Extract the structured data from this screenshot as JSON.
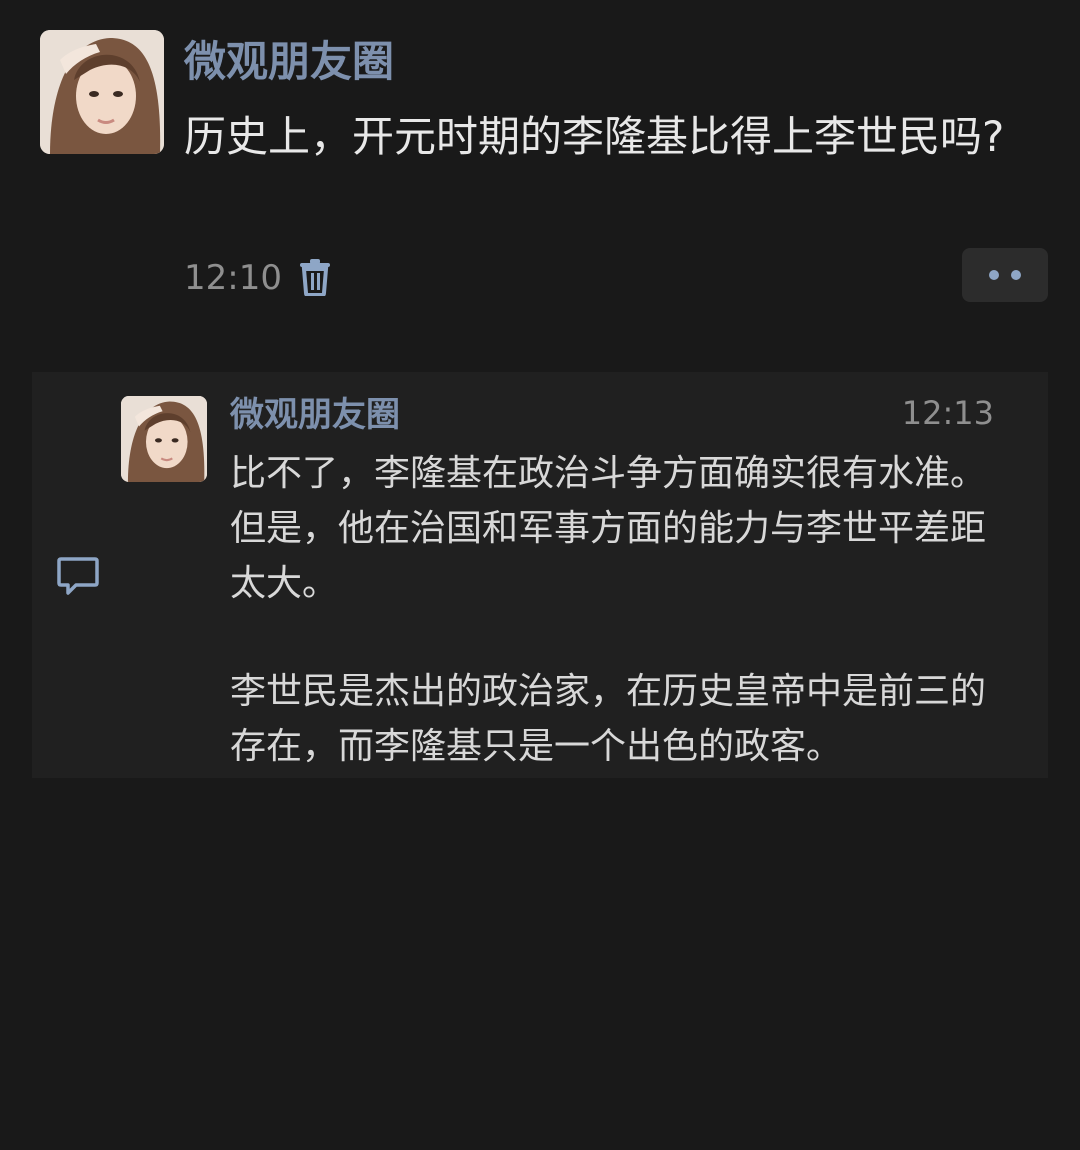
{
  "post": {
    "author": "微观朋友圈",
    "text": "历史上，开元时期的李隆基比得上李世民吗?",
    "time": "12:10",
    "delete_icon": "trash-icon",
    "more_icon": "two-dots-icon"
  },
  "comment": {
    "author": "微观朋友圈",
    "time": "12:13",
    "paragraphs": [
      "比不了，李隆基在政治斗争方面确实很有水准。但是，他在治国和军事方面的能力与李世平差距太大。",
      "李世民是杰出的政治家，在历史皇帝中是前三的存在，而李隆基只是一个出色的政客。"
    ],
    "comment_icon": "comment-bubble-icon"
  },
  "colors": {
    "background": "#191919",
    "name_accent": "#7d90ad",
    "comment_area": "#202020",
    "time_text": "#8f8f8f"
  }
}
